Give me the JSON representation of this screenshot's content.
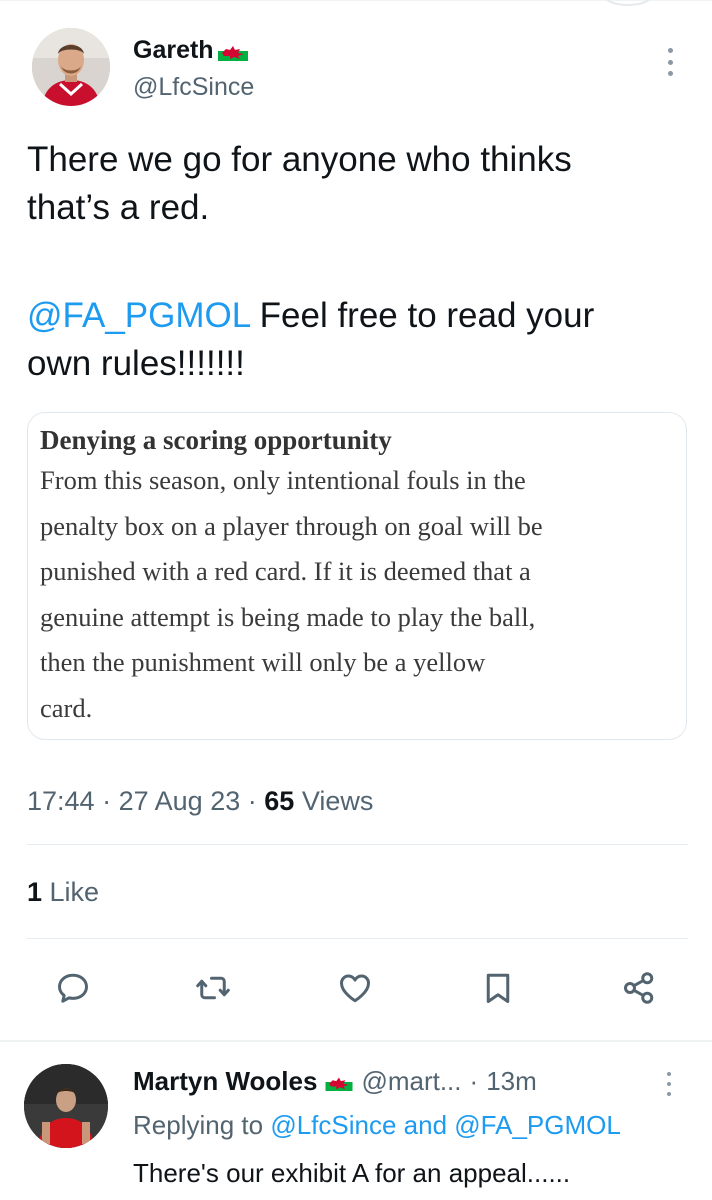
{
  "tweet": {
    "author": {
      "display_name": "Gareth",
      "handle": "@LfcSince",
      "flag_icon": "wales-flag-icon"
    },
    "text_line1": "There we go for anyone who thinks",
    "text_line2": "that’s a red.",
    "mention": "@FA_PGMOL",
    "text_line3_rest": " Feel free to read your",
    "text_line4": "own rules!!!!!!!",
    "quote": {
      "title": "Denying a scoring opportunity",
      "lines": [
        "From this season, only intentional fouls in the",
        "penalty box on a player through on goal will be",
        "punished with a red card. If it is deemed that a",
        "genuine attempt is being made to play the ball,",
        "then the punishment will only be a yellow",
        "card."
      ]
    },
    "time": "17:44",
    "sep": "·",
    "date": "27 Aug 23",
    "views_count": "65",
    "views_label": " Views",
    "likes_count": "1",
    "likes_label": " Like"
  },
  "actions": [
    {
      "name": "reply-icon"
    },
    {
      "name": "retweet-icon"
    },
    {
      "name": "like-icon"
    },
    {
      "name": "bookmark-icon"
    },
    {
      "name": "share-icon"
    }
  ],
  "reply": {
    "display_name": "Martyn Wooles",
    "handle": "@mart...",
    "dot": "·",
    "time": "13m",
    "replying_prefix": "Replying to ",
    "replying_to_1": "@LfcSince",
    "replying_and": " and ",
    "replying_to_2": "@FA_PGMOL",
    "text": "There's our exhibit A for an appeal......"
  },
  "colors": {
    "accent": "#1d9bf0",
    "secondary_text": "#536471",
    "primary_text": "#0f1419"
  }
}
